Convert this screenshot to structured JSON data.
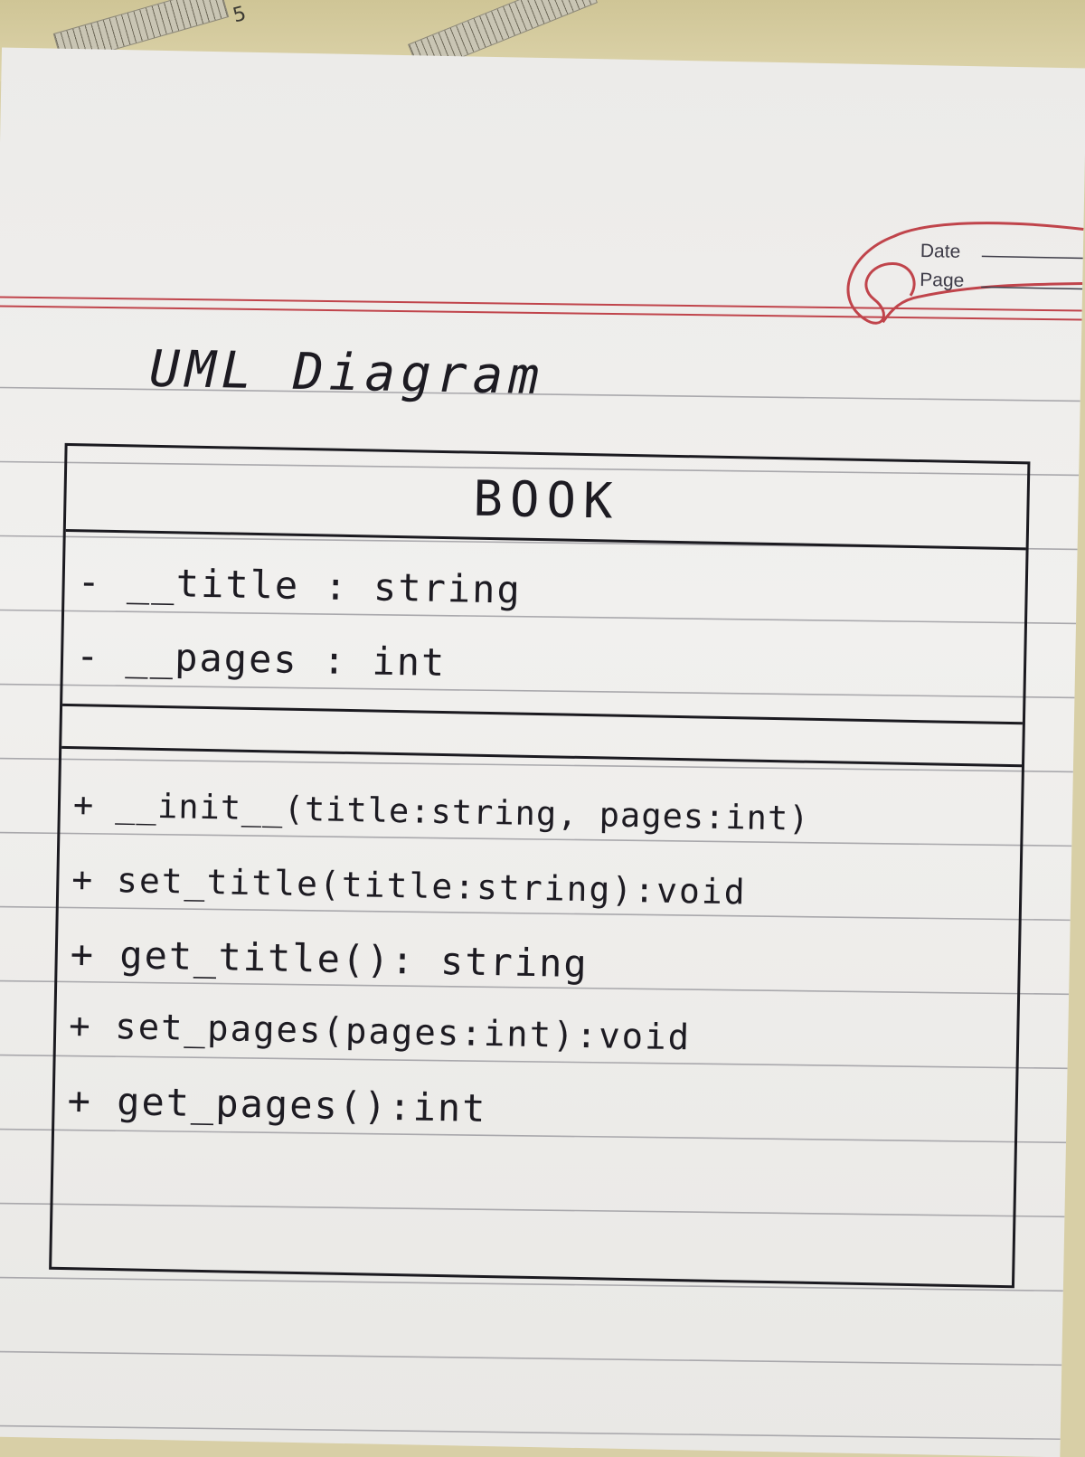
{
  "stamp": {
    "date_label": "Date",
    "page_label": "Page"
  },
  "ruler": {
    "number": "5"
  },
  "diagram": {
    "heading": "UML Diagram",
    "class_name": "BOOK",
    "attributes": [
      "- __title : string",
      "- __pages : int"
    ],
    "methods": [
      "+ __init__(title:string, pages:int)",
      "+ set_title(title:string):void",
      "+ get_title(): string",
      "+ set_pages(pages:int):void",
      "+ get_pages():int"
    ]
  },
  "colors": {
    "ink": "#1d1b22",
    "margin_rule": "#c0444b",
    "paper": "#eeedeb"
  }
}
